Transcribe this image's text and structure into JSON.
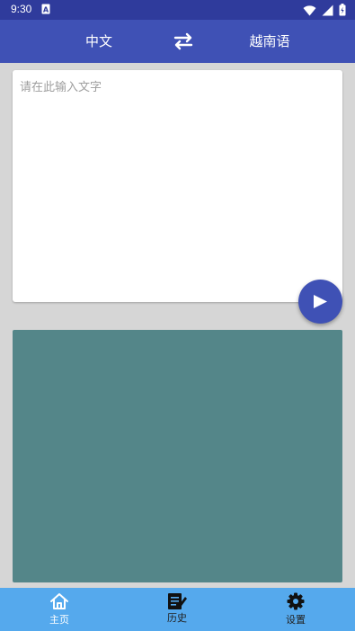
{
  "status_bar": {
    "time": "9:30"
  },
  "app_bar": {
    "source_language": "中文",
    "target_language": "越南语"
  },
  "input": {
    "placeholder": "请在此输入文字",
    "value": ""
  },
  "bottom_nav": {
    "items": [
      {
        "label": "主页",
        "icon": "home-icon",
        "selected": true
      },
      {
        "label": "历史",
        "icon": "history-icon",
        "selected": false
      },
      {
        "label": "设置",
        "icon": "gear-icon",
        "selected": false
      }
    ]
  },
  "colors": {
    "status_bar": "#2f3b9c",
    "app_bar": "#3f51b5",
    "result_panel": "#548689",
    "bottom_nav": "#55a9ed",
    "background": "#d6d6d6"
  }
}
